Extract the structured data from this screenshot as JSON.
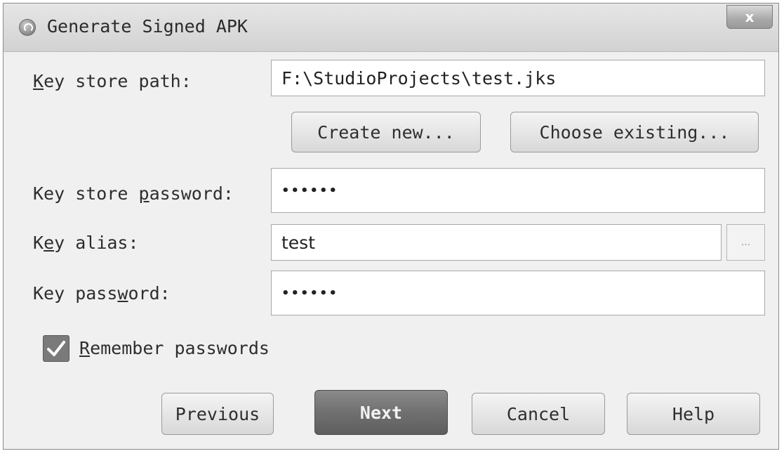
{
  "window": {
    "title": "Generate Signed APK",
    "close_label": "x"
  },
  "form": {
    "key_store_path": {
      "label_prefix": "",
      "label_mnemonic": "K",
      "label_suffix": "ey store path:",
      "value": "F:\\StudioProjects\\test.jks"
    },
    "create_new_label": "Create new...",
    "choose_existing_label": "Choose existing...",
    "key_store_password": {
      "label_prefix": "Key store ",
      "label_mnemonic": "p",
      "label_suffix": "assword:",
      "value": "••••••"
    },
    "key_alias": {
      "label_prefix": "K",
      "label_mnemonic": "e",
      "label_suffix": "y alias:",
      "value": "test",
      "browse_label": "..."
    },
    "key_password": {
      "label_prefix": "Key pass",
      "label_mnemonic": "w",
      "label_suffix": "ord:",
      "value": "••••••"
    },
    "remember_passwords": {
      "checked": true,
      "label_mnemonic": "R",
      "label_suffix": "emember passwords"
    }
  },
  "buttons": {
    "previous": "Previous",
    "next": "Next",
    "cancel": "Cancel",
    "help": "Help"
  },
  "icons": {
    "title_icon": "android-studio-icon",
    "close_icon": "close-icon",
    "check_icon": "checkmark-icon"
  }
}
